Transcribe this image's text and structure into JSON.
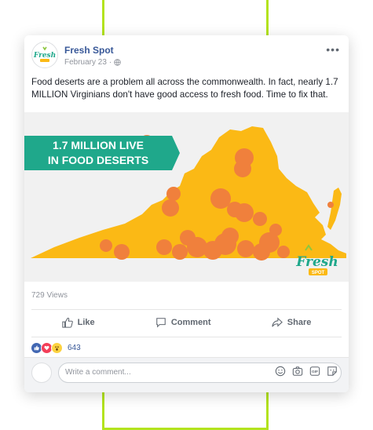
{
  "post": {
    "page_name": "Fresh Spot",
    "date": "February 23",
    "separator": "·",
    "more_label": "•••",
    "text": "Food deserts are a problem all across the commonwealth. In fact, nearly 1.7 MILLION Virginians don't have good access to fresh food. Time to fix that.",
    "image": {
      "banner_line1": "1.7 MILLION LIVE",
      "banner_line2": "IN FOOD DESERTS",
      "logo_word": "Fresh",
      "logo_sub": "SPOT"
    },
    "views": "729 Views",
    "actions": {
      "like": "Like",
      "comment": "Comment",
      "share": "Share"
    },
    "reactions_count": "643",
    "comment_placeholder": "Write a comment..."
  },
  "colors": {
    "brand_green": "#b3e31e",
    "fb_blue": "#385898",
    "teal_banner": "#1fa88b",
    "map_yellow": "#fbb915",
    "dot_orange": "#f0803c"
  },
  "icons": [
    "globe-icon",
    "like-icon",
    "comment-icon",
    "share-icon",
    "emoji-icon",
    "camera-icon",
    "gif-icon",
    "sticker-icon"
  ]
}
